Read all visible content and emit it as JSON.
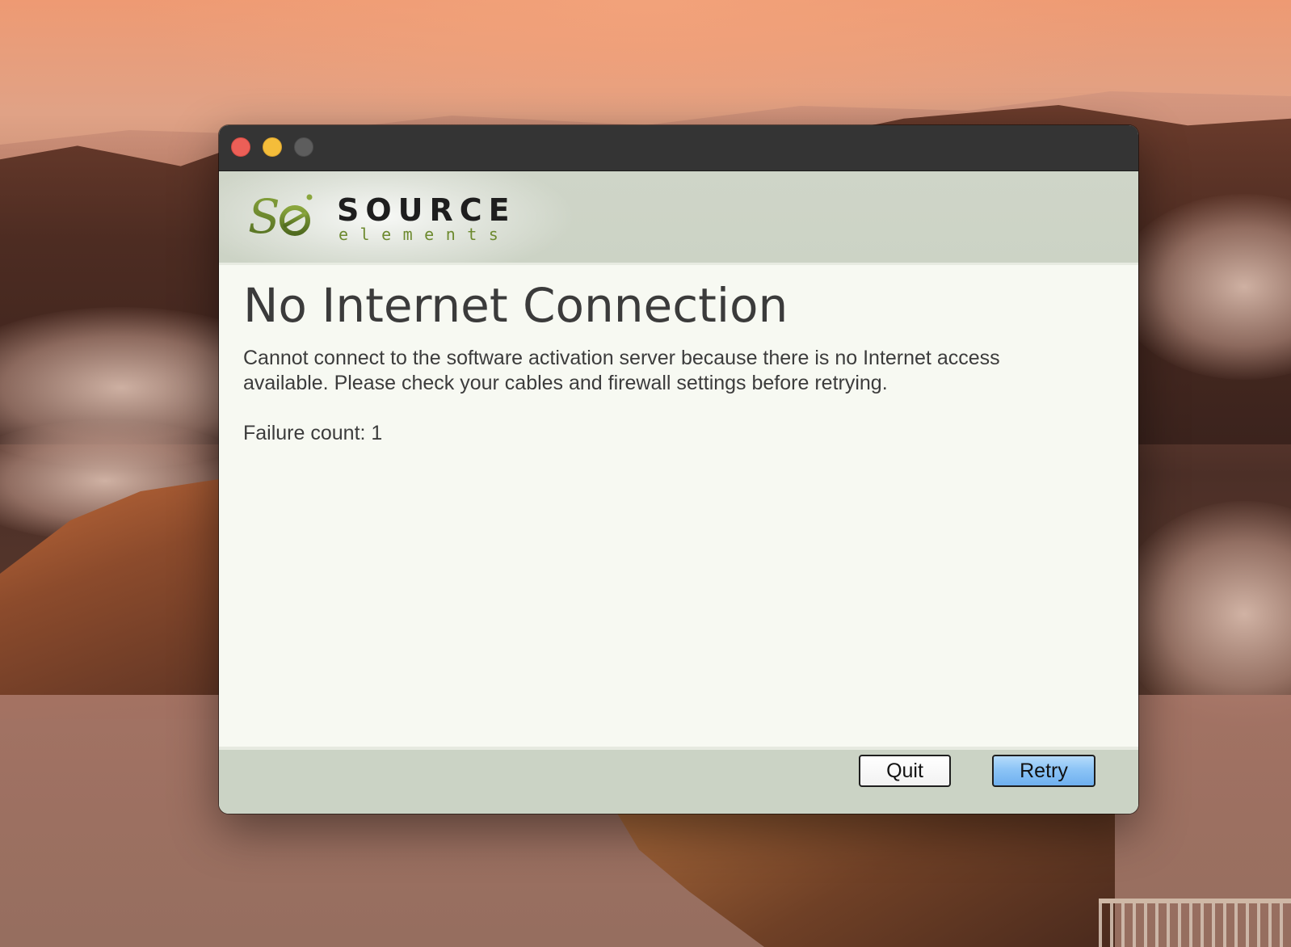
{
  "window": {
    "controls": {
      "close_icon": "close-traffic-light",
      "minimize_icon": "minimize-traffic-light",
      "zoom_icon": "zoom-traffic-light"
    }
  },
  "banner": {
    "logo_mark_text": "Se",
    "logo_name": "SOURCE",
    "logo_tagline": "elements"
  },
  "dialog": {
    "title": "No Internet Connection",
    "message": "Cannot connect to the software activation server because there is no Internet access available. Please check your cables and firewall settings before retrying.",
    "failure_label": "Failure count: 1"
  },
  "buttons": {
    "quit_label": "Quit",
    "retry_label": "Retry"
  },
  "colors": {
    "titlebar": "#343434",
    "banner": "#cfd5c8",
    "content": "#f7f9f2",
    "footer": "#cbd3c5",
    "logo_green": "#6d8a2f",
    "retry_blue": "#8cc4f6"
  }
}
